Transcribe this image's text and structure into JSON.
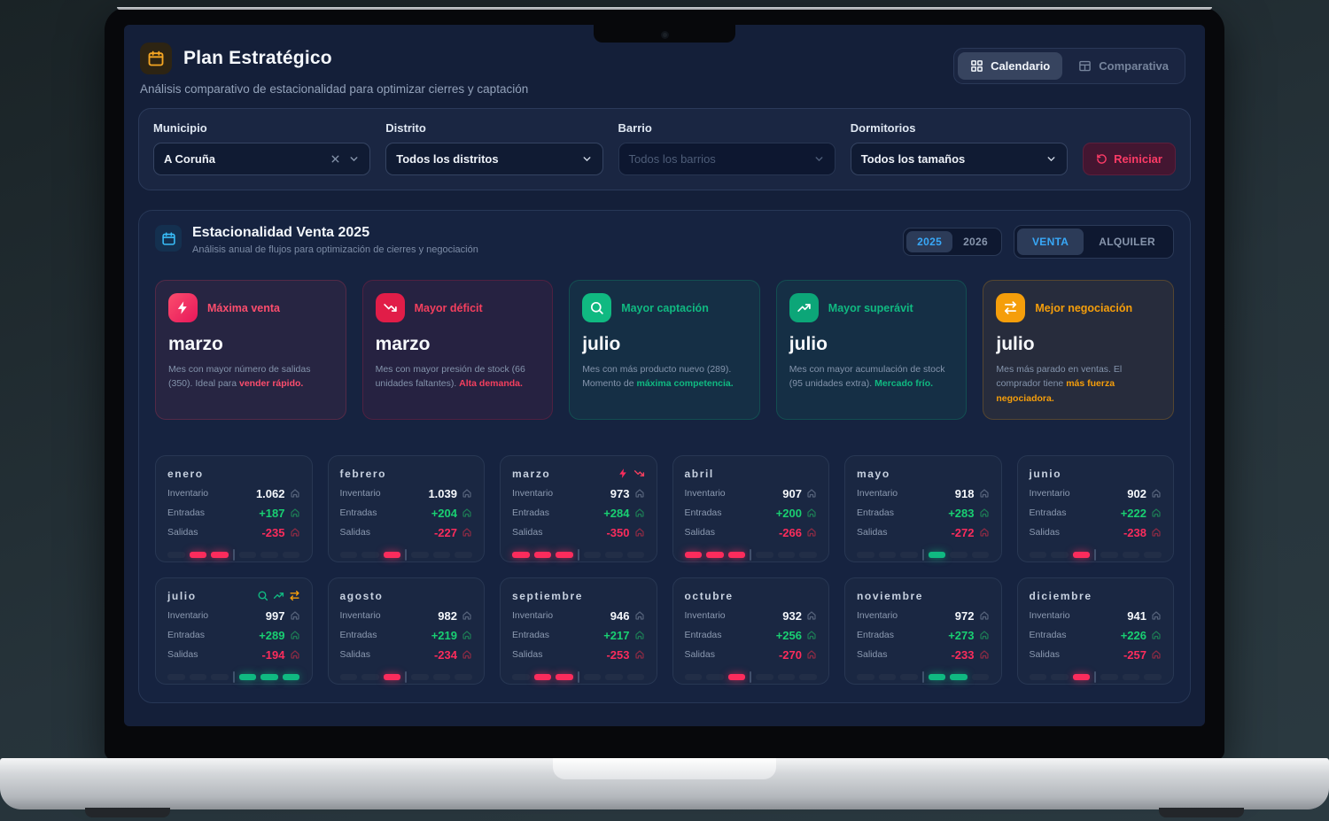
{
  "header": {
    "title": "Plan Estratégico",
    "subtitle": "Análisis comparativo de estacionalidad para optimizar cierres y captación",
    "tab_calendario": "Calendario",
    "tab_comparativa": "Comparativa"
  },
  "filters": {
    "municipio": {
      "label": "Municipio",
      "value": "A Coruña"
    },
    "distrito": {
      "label": "Distrito",
      "value": "Todos los distritos"
    },
    "barrio": {
      "label": "Barrio",
      "value": "Todos los barrios"
    },
    "dormitorios": {
      "label": "Dormitorios",
      "value": "Todos los tamaños"
    },
    "reset_label": "Reiniciar"
  },
  "season": {
    "title": "Estacionalidad Venta 2025",
    "subtitle": "Análisis anual de flujos para optimización de cierres y negociación",
    "year_active": "2025",
    "year_inactive": "2026",
    "mode_active": "VENTA",
    "mode_inactive": "ALQUILER"
  },
  "highlights": [
    {
      "label": "Máxima venta",
      "month": "marzo",
      "desc": "Mes con mayor número de salidas (350). Ideal para",
      "emphasis": "vender rápido.",
      "accent": "#f43f5e"
    },
    {
      "label": "Mayor déficit",
      "month": "marzo",
      "desc": "Mes con mayor presión de stock (66 unidades faltantes).",
      "emphasis": "Alta demanda.",
      "accent": "#e11d48"
    },
    {
      "label": "Mayor captación",
      "month": "julio",
      "desc": "Mes con más producto nuevo (289). Momento de",
      "emphasis": "máxima competencia.",
      "accent": "#10b981"
    },
    {
      "label": "Mayor superávit",
      "month": "julio",
      "desc": "Mes con mayor acumulación de stock (95 unidades extra).",
      "emphasis": "Mercado frío.",
      "accent": "#10b981"
    },
    {
      "label": "Mejor negociación",
      "month": "julio",
      "desc": "Mes más parado en ventas. El comprador tiene",
      "emphasis": "más fuerza negociadora.",
      "accent": "#f59e0b"
    }
  ],
  "month_labels": {
    "inventory": "Inventario",
    "inflow": "Entradas",
    "outflow": "Salidas"
  },
  "months": [
    {
      "name": "enero",
      "inventory": "1.062",
      "inflow": "+187",
      "outflow": "-235",
      "badges": [],
      "bars": [
        "dark",
        "pink",
        "pink",
        "dark",
        "dark",
        "dark"
      ]
    },
    {
      "name": "febrero",
      "inventory": "1.039",
      "inflow": "+204",
      "outflow": "-227",
      "badges": [],
      "bars": [
        "dark",
        "dark",
        "pink",
        "dark",
        "dark",
        "dark"
      ]
    },
    {
      "name": "marzo",
      "inventory": "973",
      "inflow": "+284",
      "outflow": "-350",
      "badges": [
        {
          "icon": "bolt",
          "color": "pink"
        },
        {
          "icon": "trend-down",
          "color": "red"
        }
      ],
      "bars": [
        "pink",
        "pink",
        "pink",
        "dark",
        "dark",
        "dark"
      ]
    },
    {
      "name": "abril",
      "inventory": "907",
      "inflow": "+200",
      "outflow": "-266",
      "badges": [],
      "bars": [
        "pink",
        "pink",
        "pink",
        "dark",
        "dark",
        "dark"
      ]
    },
    {
      "name": "mayo",
      "inventory": "918",
      "inflow": "+283",
      "outflow": "-272",
      "badges": [],
      "bars": [
        "dark",
        "dark",
        "dark",
        "green",
        "dark",
        "dark"
      ]
    },
    {
      "name": "junio",
      "inventory": "902",
      "inflow": "+222",
      "outflow": "-238",
      "badges": [],
      "bars": [
        "dark",
        "dark",
        "pink",
        "dark",
        "dark",
        "dark"
      ]
    },
    {
      "name": "julio",
      "inventory": "997",
      "inflow": "+289",
      "outflow": "-194",
      "badges": [
        {
          "icon": "search",
          "color": "green"
        },
        {
          "icon": "trend-up",
          "color": "green"
        },
        {
          "icon": "swap",
          "color": "orange"
        }
      ],
      "bars": [
        "dark",
        "dark",
        "dark",
        "green",
        "green",
        "green"
      ]
    },
    {
      "name": "agosto",
      "inventory": "982",
      "inflow": "+219",
      "outflow": "-234",
      "badges": [],
      "bars": [
        "dark",
        "dark",
        "pink",
        "dark",
        "dark",
        "dark"
      ]
    },
    {
      "name": "septiembre",
      "inventory": "946",
      "inflow": "+217",
      "outflow": "-253",
      "badges": [],
      "bars": [
        "dark",
        "pink",
        "pink",
        "dark",
        "dark",
        "dark"
      ]
    },
    {
      "name": "octubre",
      "inventory": "932",
      "inflow": "+256",
      "outflow": "-270",
      "badges": [],
      "bars": [
        "dark",
        "dark",
        "pink",
        "dark",
        "dark",
        "dark"
      ]
    },
    {
      "name": "noviembre",
      "inventory": "972",
      "inflow": "+273",
      "outflow": "-233",
      "badges": [],
      "bars": [
        "dark",
        "dark",
        "dark",
        "green",
        "green",
        "dark"
      ]
    },
    {
      "name": "diciembre",
      "inventory": "941",
      "inflow": "+226",
      "outflow": "-257",
      "badges": [],
      "bars": [
        "dark",
        "dark",
        "pink",
        "dark",
        "dark",
        "dark"
      ]
    }
  ],
  "colors": {
    "accent_blue": "#38bdf8",
    "accent_pink": "#f43f5e",
    "accent_green": "#10b981",
    "accent_orange": "#f59e0b"
  }
}
